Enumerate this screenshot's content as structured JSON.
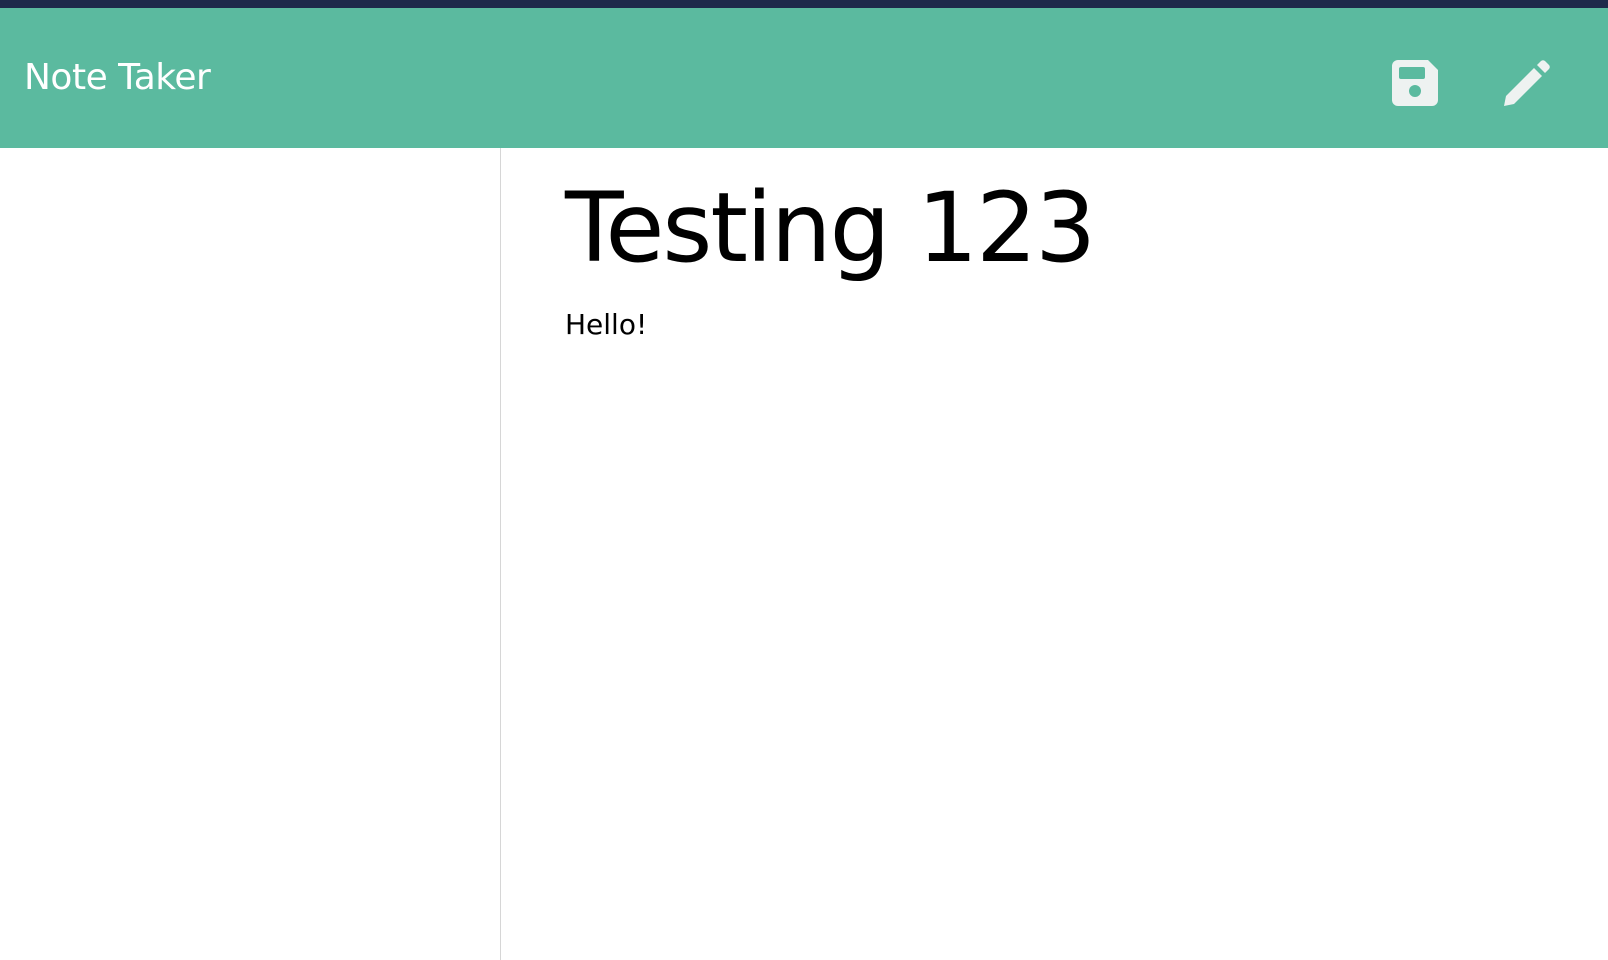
{
  "app": {
    "brand": "Note Taker"
  },
  "navbar": {
    "icons": [
      {
        "name": "save-icon"
      },
      {
        "name": "pencil-icon"
      }
    ]
  },
  "note": {
    "title": "Testing 123",
    "text": "Hello!"
  },
  "colors": {
    "navbar": "#5bba9f",
    "top_strip": "#1e2a4a",
    "icon": "#eef2f1",
    "divider": "#d6d6d6"
  }
}
